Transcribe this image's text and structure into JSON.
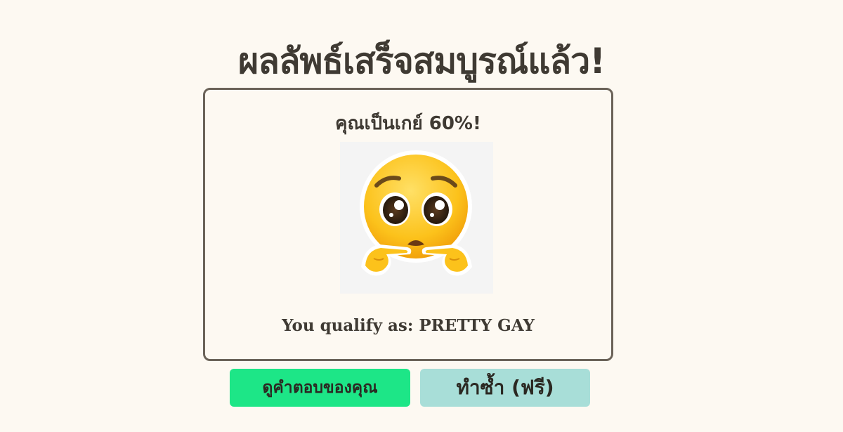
{
  "page": {
    "title": "ผลลัพธ์เสร็จสมบูรณ์แล้ว!"
  },
  "result": {
    "percent_text": "คุณเป็นเกย์ 60%!",
    "image_icon": "pleading-face-emoji-icon",
    "qualify_text": "You qualify as: PRETTY GAY"
  },
  "actions": {
    "view_answers_label": "ดูคำตอบของคุณ",
    "retake_label": "ทำซ้ำ (ฟรี)"
  },
  "colors": {
    "background": "#fdf9f2",
    "text": "#3f3a33",
    "card_border": "#6b6359",
    "view_answers_button": "#1de687",
    "retake_button": "#a8ded8"
  }
}
